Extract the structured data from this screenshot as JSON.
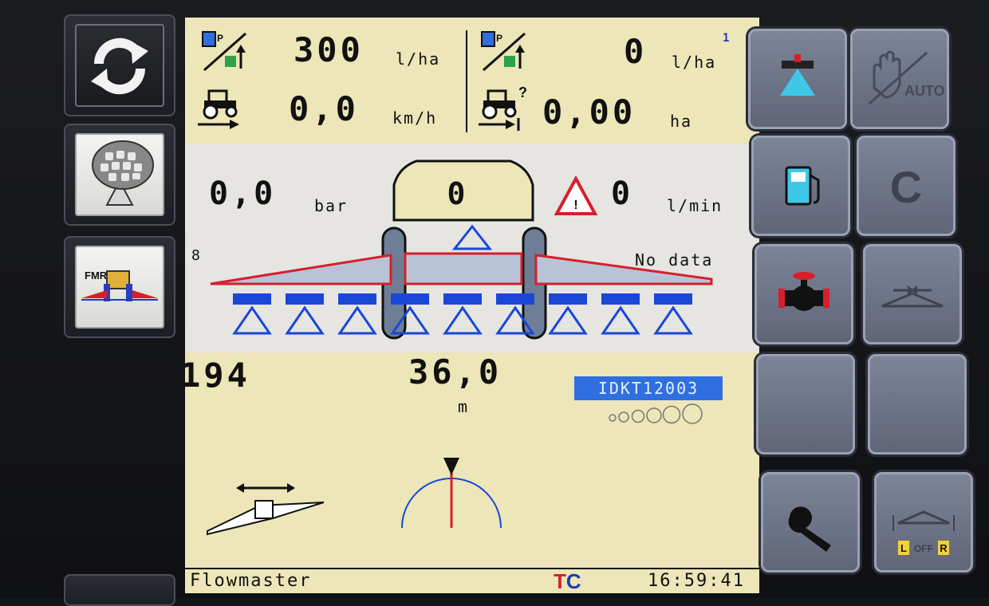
{
  "top_left": {
    "rate_value": "300",
    "rate_unit": "l/ha",
    "speed_value": "0,0",
    "speed_unit": "km/h"
  },
  "top_right": {
    "rate_value": "0",
    "rate_unit": "l/ha",
    "area_value": "0,00",
    "area_unit": "ha",
    "badge": "1"
  },
  "boom": {
    "pressure_value": "0,0",
    "pressure_unit": "bar",
    "tank_value": "0",
    "flow_value": "0",
    "flow_unit": "l/min",
    "section_count": "8",
    "status_text": "No data",
    "sections": 9
  },
  "bottom": {
    "left_value": "194",
    "width_value": "36,0",
    "width_unit": "m",
    "device_id": "IDKT12003"
  },
  "status_bar": {
    "app_name": "Flowmaster",
    "logo_t": "T",
    "logo_c": "C",
    "time": "16:59:41"
  },
  "softkeys_left": {
    "fmr_label": "FMR"
  },
  "softkeys_right": {
    "auto_label": "AUTO",
    "clear_label": "C",
    "lr_left": "L",
    "lr_off": "OFF",
    "lr_right": "R"
  },
  "colors": {
    "screen_bg": "#ece6b8",
    "mid_bg": "#e6e5e1",
    "accent_blue": "#2f6fe0",
    "alarm_red": "#d61f2b"
  }
}
